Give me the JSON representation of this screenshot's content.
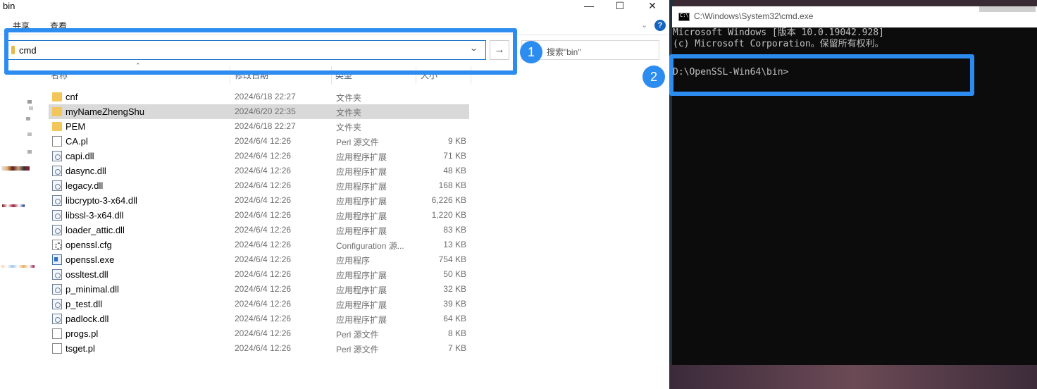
{
  "explorer": {
    "title": "bin",
    "window_buttons": {
      "minimize": "—",
      "maximize": "☐",
      "close": "✕"
    },
    "ribbon_tabs": [
      "共享",
      "查看"
    ],
    "help": "?",
    "address": {
      "value": "cmd",
      "dropdown": "⌄",
      "go": "→"
    },
    "search": {
      "placeholder": "搜索\"bin\""
    },
    "columns": {
      "name": "名称",
      "date": "修改日期",
      "type": "类型",
      "size": "大小"
    },
    "files": [
      {
        "name": "cnf",
        "date": "2024/6/18 22:27",
        "type": "文件夹",
        "size": "",
        "icon": "folder-icon"
      },
      {
        "name": "myNameZhengShu",
        "date": "2024/6/20 22:35",
        "type": "文件夹",
        "size": "",
        "icon": "folder-icon",
        "selected": true
      },
      {
        "name": "PEM",
        "date": "2024/6/18 22:27",
        "type": "文件夹",
        "size": "",
        "icon": "folder-icon"
      },
      {
        "name": "CA.pl",
        "date": "2024/6/4 12:26",
        "type": "Perl 源文件",
        "size": "9 KB",
        "icon": "file-icon"
      },
      {
        "name": "capi.dll",
        "date": "2024/6/4 12:26",
        "type": "应用程序扩展",
        "size": "71 KB",
        "icon": "dll-icon"
      },
      {
        "name": "dasync.dll",
        "date": "2024/6/4 12:26",
        "type": "应用程序扩展",
        "size": "48 KB",
        "icon": "dll-icon"
      },
      {
        "name": "legacy.dll",
        "date": "2024/6/4 12:26",
        "type": "应用程序扩展",
        "size": "168 KB",
        "icon": "dll-icon"
      },
      {
        "name": "libcrypto-3-x64.dll",
        "date": "2024/6/4 12:26",
        "type": "应用程序扩展",
        "size": "6,226 KB",
        "icon": "dll-icon"
      },
      {
        "name": "libssl-3-x64.dll",
        "date": "2024/6/4 12:26",
        "type": "应用程序扩展",
        "size": "1,220 KB",
        "icon": "dll-icon"
      },
      {
        "name": "loader_attic.dll",
        "date": "2024/6/4 12:26",
        "type": "应用程序扩展",
        "size": "83 KB",
        "icon": "dll-icon"
      },
      {
        "name": "openssl.cfg",
        "date": "2024/6/4 12:26",
        "type": "Configuration 源...",
        "size": "13 KB",
        "icon": "config-file-icon"
      },
      {
        "name": "openssl.exe",
        "date": "2024/6/4 12:26",
        "type": "应用程序",
        "size": "754 KB",
        "icon": "exe-icon"
      },
      {
        "name": "ossltest.dll",
        "date": "2024/6/4 12:26",
        "type": "应用程序扩展",
        "size": "50 KB",
        "icon": "dll-icon"
      },
      {
        "name": "p_minimal.dll",
        "date": "2024/6/4 12:26",
        "type": "应用程序扩展",
        "size": "32 KB",
        "icon": "dll-icon"
      },
      {
        "name": "p_test.dll",
        "date": "2024/6/4 12:26",
        "type": "应用程序扩展",
        "size": "39 KB",
        "icon": "dll-icon"
      },
      {
        "name": "padlock.dll",
        "date": "2024/6/4 12:26",
        "type": "应用程序扩展",
        "size": "64 KB",
        "icon": "dll-icon"
      },
      {
        "name": "progs.pl",
        "date": "2024/6/4 12:26",
        "type": "Perl 源文件",
        "size": "8 KB",
        "icon": "file-icon"
      },
      {
        "name": "tsget.pl",
        "date": "2024/6/4 12:26",
        "type": "Perl 源文件",
        "size": "7 KB",
        "icon": "file-icon"
      }
    ]
  },
  "annotations": {
    "marker_1": "1",
    "marker_2": "2",
    "highlight_color": "#2d8cf0"
  },
  "cmd": {
    "title": "C:\\Windows\\System32\\cmd.exe",
    "lines": [
      "Microsoft Windows [版本 10.0.19042.928]",
      "(c) Microsoft Corporation。保留所有权利。",
      "D:\\OpenSSL-Win64\\bin>"
    ]
  }
}
